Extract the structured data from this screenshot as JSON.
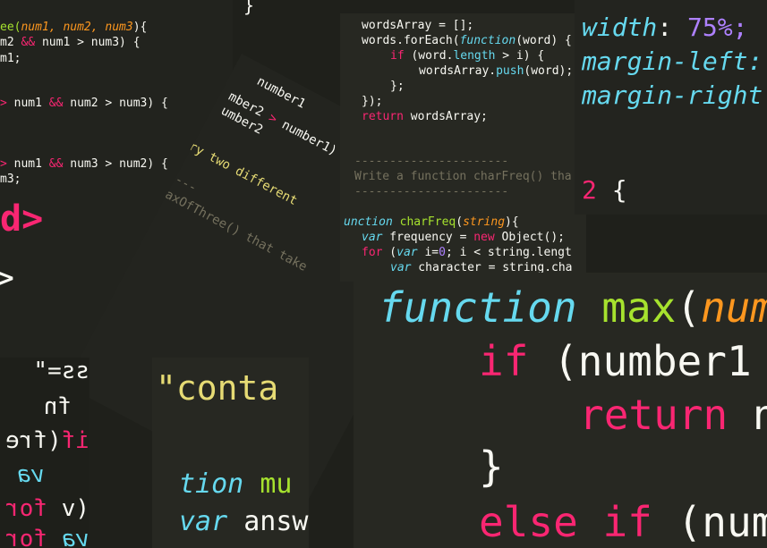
{
  "colors": {
    "background": "#1f201b",
    "keyword": "#f92672",
    "function_name": "#a6e22e",
    "type_keyword": "#66d9ef",
    "argument": "#fd971f",
    "plain_text": "#f8f8f2",
    "comment": "#75715e",
    "string": "#e6db74",
    "number": "#ae81ff"
  },
  "panel_top_left": {
    "l1_a": "ee(",
    "l1_b": "num1, num2, num3",
    "l1_c": "){",
    "l2_a": "m2 ",
    "l2_b": "&&",
    "l2_c": " num1 > num3) {",
    "l3": "m1;",
    "l4_a": "> ",
    "l4_b": "num1 ",
    "l4_c": "&&",
    "l4_d": " num2 > num3) {",
    "l5_a": "> ",
    "l5_b": "num1 ",
    "l5_c": "&&",
    "l5_d": " num3 > num2) {",
    "l6": "m3;",
    "brace": "}",
    "big1": "d>",
    "big2": ">"
  },
  "panel_top_center": {
    "l1": "wordsArray = [];",
    "l2_a": "words.forEach(",
    "l2_b": "function",
    "l2_c": "(word) {",
    "l3_a": "if",
    "l3_b": " (word.",
    "l3_c": "length",
    "l3_d": " > i) {",
    "l4_a": "wordsArray.",
    "l4_b": "push",
    "l4_c": "(word);",
    "l5": "};",
    "l6": "});",
    "l7_a": "return",
    "l7_b": " wordsArray;",
    "c1": "----------------------",
    "c2": "Write a function charFreq() tha",
    "c3": "----------------------",
    "l8_a": "unction ",
    "l8_b": "charFreq",
    "l8_c": "(",
    "l8_d": "string",
    "l8_e": "){",
    "l9_a": "var",
    "l9_b": " frequency = ",
    "l9_c": "new",
    "l9_d": " Object();",
    "l10_a": "for",
    "l10_b": " (",
    "l10_c": "var",
    "l10_d": " i=",
    "l10_e": "0",
    "l10_f": "; i < string.lengt",
    "l11_a": "var",
    "l11_b": " character = string.cha"
  },
  "panel_top_right": {
    "l1_a": "width",
    "l1_b": ": ",
    "l1_c": "75%;",
    "l2": "margin-left:",
    "l3": "margin-right",
    "l4_a": "2",
    "l4_b": " {"
  },
  "panel_rotated": {
    "l1": "number1 ",
    "l2_a": "mber2 ",
    "l2_b": ">",
    "l2_c": " number1) {",
    "l3": "umber2",
    "l4": "'Try two different ",
    "l5": "---------",
    "l6": "ction maxOfThree() that take"
  },
  "panel_bottom_left": {
    "l1": "ss=\"",
    "l2": "fn",
    "l3_a": "(fre",
    "l3_b": "if",
    "l4": "va",
    "l5_a": "for",
    "l5_b": "(v",
    "l6_a": "for",
    "l6_b": "va"
  },
  "panel_bottom_mid": {
    "l1": "\"conta",
    "l2_a": "tion ",
    "l2_b": "mu",
    "l3_a": "var",
    "l3_b": " answ"
  },
  "panel_bottom_right": {
    "l1_a": "function ",
    "l1_b": "max",
    "l1_c": "(",
    "l1_d": "num",
    "l2_a": "if",
    "l2_b": " (number1",
    "l3_a": "return",
    "l3_b": " n",
    "l4": "}",
    "l5_a": "else ",
    "l5_b": "if",
    "l5_c": " (num"
  }
}
